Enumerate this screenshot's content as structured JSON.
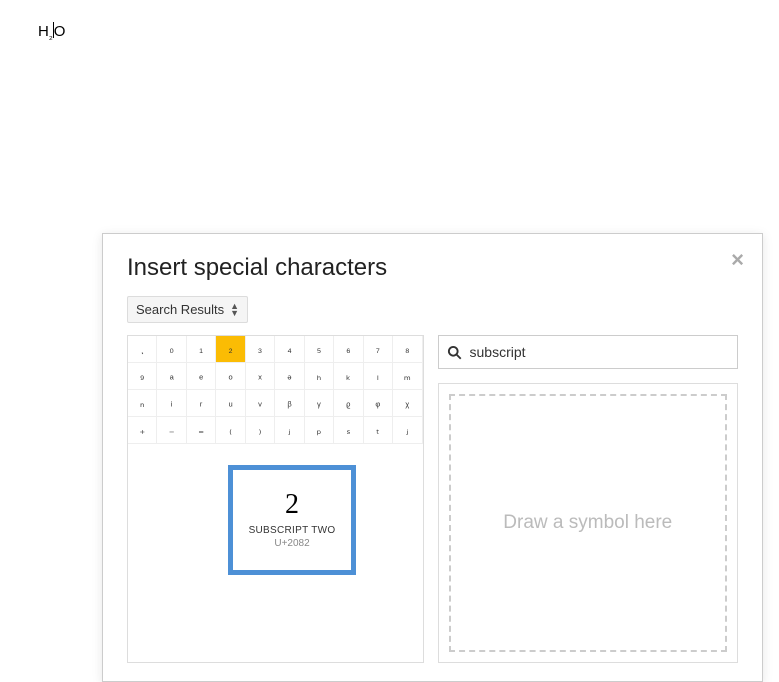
{
  "document": {
    "before": "H",
    "sub": "₂",
    "after": "O"
  },
  "dialog": {
    "title": "Insert special characters",
    "dropdown_label": "Search Results",
    "search_value": "subscript",
    "draw_placeholder": "Draw a symbol here"
  },
  "tooltip": {
    "char": "2",
    "name": "SUBSCRIPT TWO",
    "code": "U+2082"
  },
  "grid": {
    "rows": [
      [
        "ͅ",
        "₀",
        "₁",
        "₂",
        "₃",
        "₄",
        "₅",
        "₆",
        "₇",
        "₈"
      ],
      [
        "₉",
        "ₐ",
        "ₑ",
        "ₒ",
        "ₓ",
        "ₔ",
        "ₕ",
        "ₖ",
        "ₗ",
        "ₘ"
      ],
      [
        "ₙ",
        "ᵢ",
        "ᵣ",
        "ᵤ",
        "ᵥ",
        "ᵦ",
        "ᵧ",
        "ᵨ",
        "ᵩ",
        "ᵪ"
      ],
      [
        "₊",
        "₋",
        "₌",
        "₍",
        "₎",
        "ⱼ",
        "ₚ",
        "ₛ",
        "ₜ",
        "ⱼ"
      ]
    ],
    "selected_row": 0,
    "selected_col": 3
  }
}
